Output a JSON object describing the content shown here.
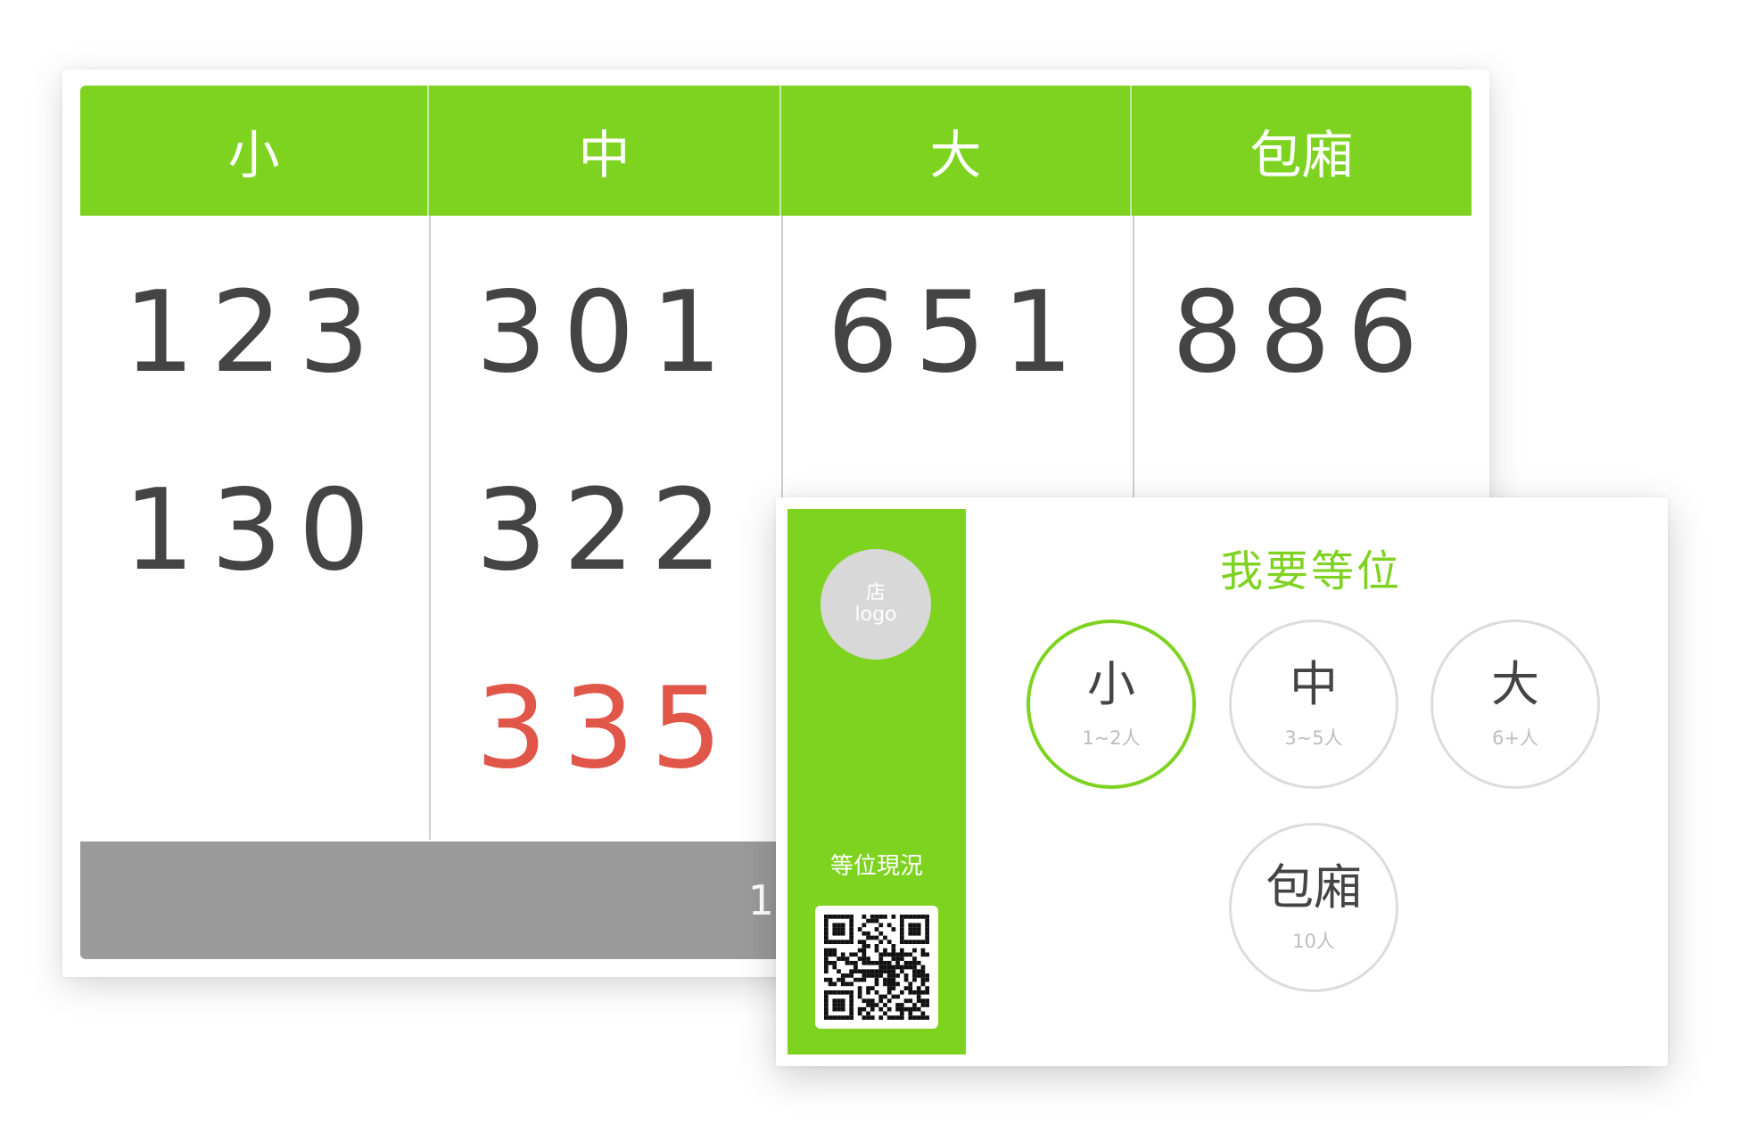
{
  "queue_board": {
    "columns": [
      {
        "header": "小",
        "numbers": [
          "123",
          "130"
        ]
      },
      {
        "header": "中",
        "numbers": [
          "301",
          "322",
          "335"
        ]
      },
      {
        "header": "大",
        "numbers": [
          "651"
        ]
      },
      {
        "header": "包廂",
        "numbers": [
          "886"
        ]
      }
    ],
    "highlighted_number": "335",
    "highlight_color": "#e0574a",
    "footer_text": "19"
  },
  "registration": {
    "logo": {
      "line1": "店",
      "line2": "logo"
    },
    "status_label": "等位現況",
    "title": "我要等位",
    "options": [
      {
        "name": "小",
        "range": "1~2人",
        "selected": true
      },
      {
        "name": "中",
        "range": "3~5人",
        "selected": false
      },
      {
        "name": "大",
        "range": "6+人",
        "selected": false
      },
      {
        "name": "包廂",
        "range": "10人",
        "selected": false
      }
    ]
  },
  "colors": {
    "accent_green": "#7ed321",
    "footer_gray": "#9b9b9b",
    "number_text": "#444444"
  },
  "icons": [
    "qr-code-icon"
  ]
}
